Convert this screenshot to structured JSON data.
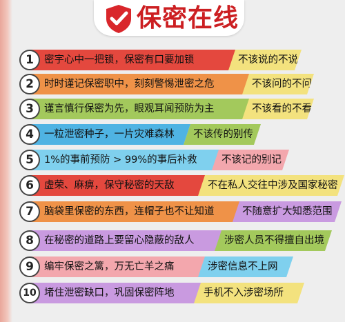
{
  "header": {
    "title": "保密在线",
    "icon": "shield-check-icon"
  },
  "colors": {
    "title_red": "#cc1f22",
    "background": "#eeeeee"
  },
  "rules": [
    {
      "number": "1",
      "text": "密宇心中一把锁，保密有口要加锁",
      "tag": "不该说的不说"
    },
    {
      "number": "2",
      "text": "时时谨记保密职中，刻刻警惕泄密之危",
      "tag": "不该问的不问"
    },
    {
      "number": "3",
      "text": "谨言慎行保密为先，眼观耳闻预防为主",
      "tag": "不该看的不看"
    },
    {
      "number": "4",
      "text": "一粒泄密种子，一片灾难森林",
      "tag": "不该传的别传"
    },
    {
      "number": "5",
      "text": "1%的事前预防 > 99%的事后补救",
      "tag": "不该记的别记"
    },
    {
      "number": "6",
      "text": "虚荣、麻痹，保守秘密的天敌",
      "tag": "不在私人交往中涉及国家秘密"
    },
    {
      "number": "7",
      "text": "脑袋里保密的东西，连帽子也不让知道",
      "tag": "不随意扩大知悉范围"
    },
    {
      "number": "8",
      "text": "在秘密的道路上要留心隐蔽的敌人",
      "tag": "涉密人员不得擅自出境"
    },
    {
      "number": "9",
      "text": "编牢保密之篱，万无亡羊之痛",
      "tag": "涉密信息不上网"
    },
    {
      "number": "10",
      "text": "堵住泄密缺口，巩固保密阵地",
      "tag": "手机不入涉密场所"
    }
  ]
}
